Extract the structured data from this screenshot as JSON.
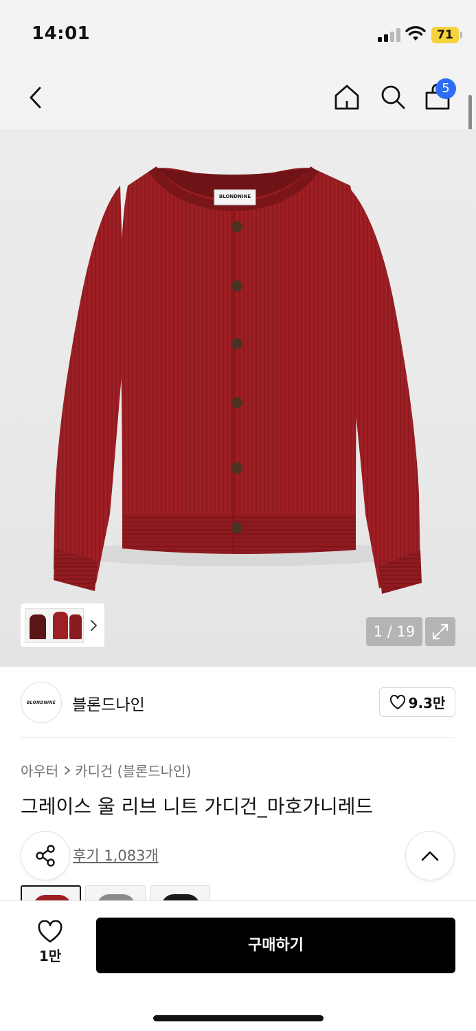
{
  "status_bar": {
    "time": "14:01",
    "battery": "71"
  },
  "nav": {
    "back_icon": "chevron-left-icon",
    "home_icon": "home-icon",
    "search_icon": "search-icon",
    "cart_icon": "shopping-bag-icon",
    "cart_count": "5"
  },
  "gallery": {
    "label_text": "BLONDNINE",
    "page_counter": "1 / 19",
    "expand_icon": "expand-icon",
    "thumbnail_chevron_icon": "chevron-right-icon"
  },
  "brand": {
    "logo_text": "BLONDNINE",
    "name": "블론드나인",
    "like_count": "9.3만"
  },
  "breadcrumb": {
    "category": "아우터",
    "subcategory": "카디건 (블론드나인)"
  },
  "product": {
    "title": "그레이스 울 리브 니트 가디건_마호가니레드",
    "review_text": "후기 1,083개"
  },
  "swatch_colors": [
    "#9e1f24",
    "#8b8b8b",
    "#1a1a1a"
  ],
  "bottom_bar": {
    "wish_count": "1만",
    "buy_label": "구매하기"
  },
  "colors": {
    "product_red": "#9e1f24",
    "badge_blue": "#2e6cf6",
    "battery_yellow": "#f6d23c",
    "buy_button": "#000000"
  }
}
